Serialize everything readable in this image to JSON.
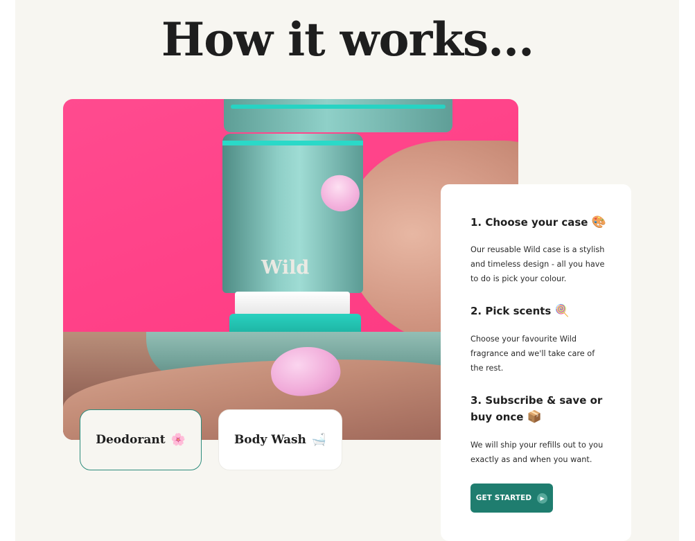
{
  "section": {
    "title": "How it works..."
  },
  "hero": {
    "brand": "Wild"
  },
  "tabs": [
    {
      "label": "Deodorant",
      "emoji": "🌸",
      "active": true
    },
    {
      "label": "Body Wash",
      "emoji": "🛁",
      "active": false
    }
  ],
  "steps": [
    {
      "title": "1. Choose your case",
      "emoji": "🎨",
      "text": "Our reusable Wild case is a stylish and timeless design - all you have to do is pick your colour."
    },
    {
      "title": "2. Pick scents",
      "emoji": "🍭",
      "text": "Choose your favourite Wild fragrance and we'll take care of the rest."
    },
    {
      "title": "3. Subscribe & save or buy once",
      "emoji": "📦",
      "text": "We will ship your refills out to you exactly as and when you want."
    }
  ],
  "cta": {
    "label": "GET STARTED",
    "icon": "arrow-right-icon"
  },
  "colors": {
    "accent": "#1f7d6f",
    "hero_pink": "#ff4b8f",
    "panel": "#f7f6f1"
  }
}
